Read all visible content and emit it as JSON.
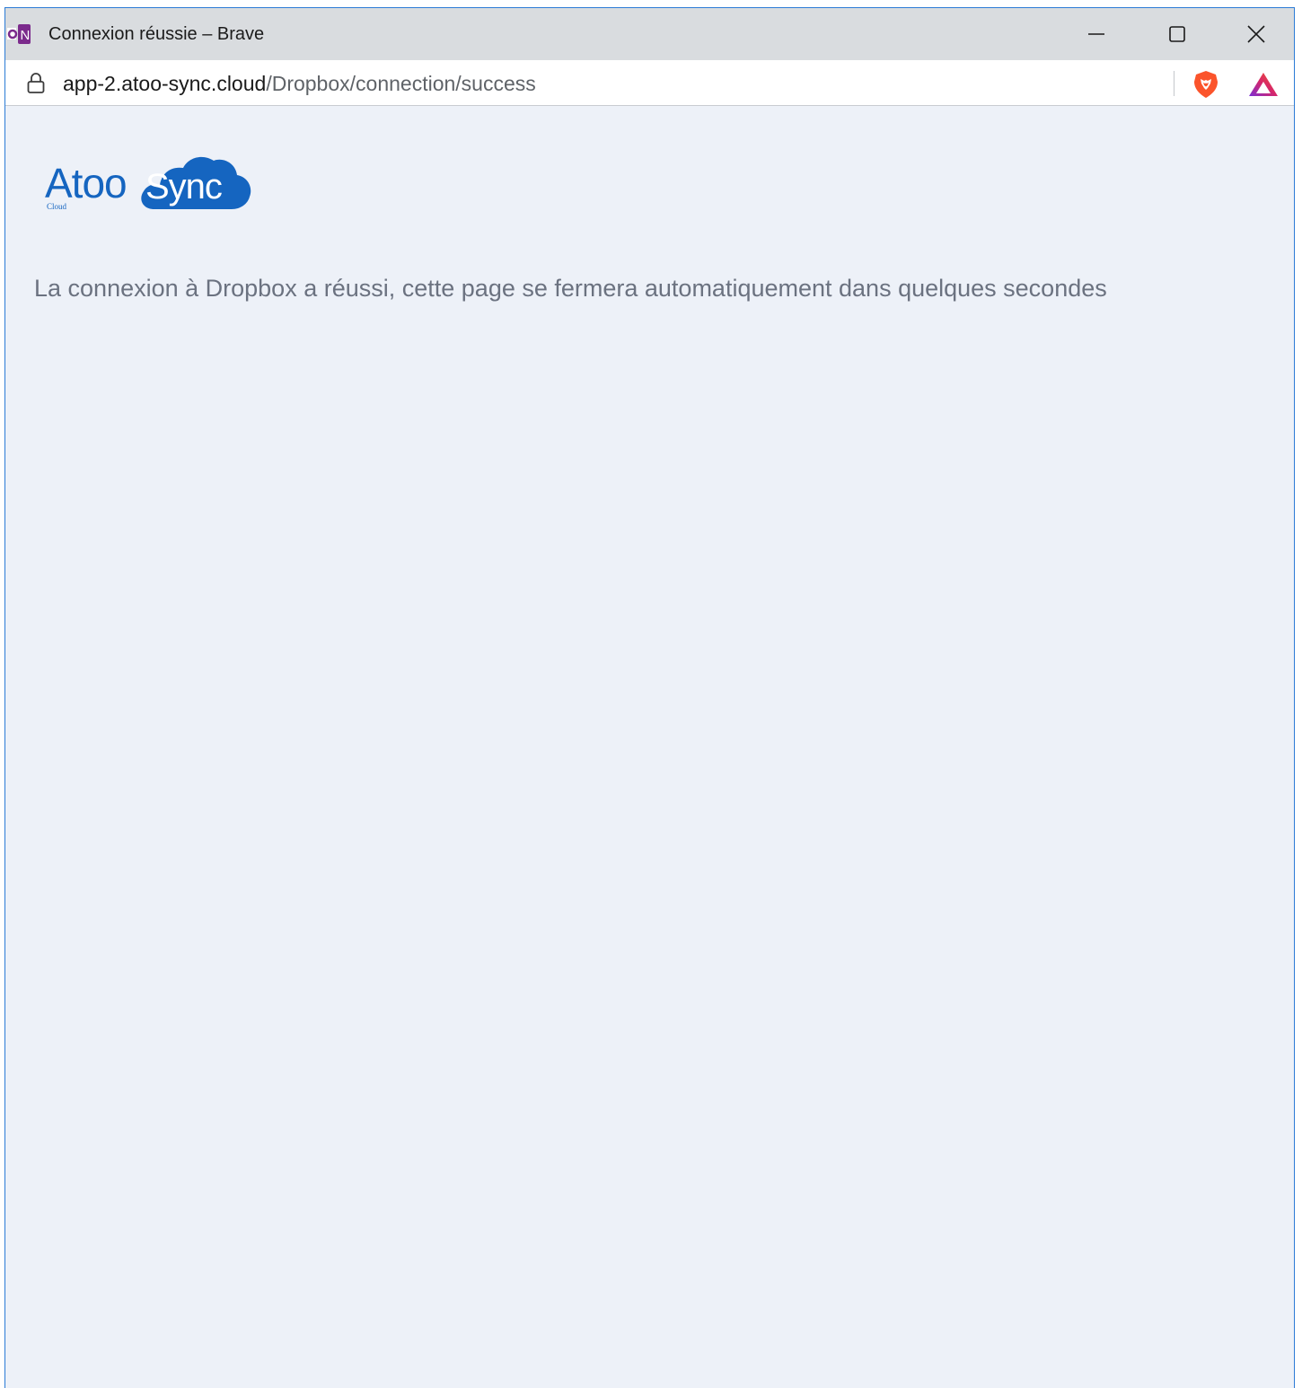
{
  "window": {
    "title": "Connexion réussie – Brave",
    "favicon_letter": "N",
    "controls": {
      "minimize_icon": "minimize-icon",
      "maximize_icon": "maximize-icon",
      "close_icon": "close-icon"
    }
  },
  "address_bar": {
    "url_host": "app-2.atoo-sync.cloud",
    "url_path": "/Dropbox/connection/success",
    "lock_icon": "lock-icon",
    "shield_icon": "brave-shield-icon",
    "rewards_icon": "brave-rewards-icon"
  },
  "page": {
    "logo": {
      "word_left": "Atoo",
      "word_right": "Sync",
      "subtext": "Cloud",
      "brand_color": "#1565c0"
    },
    "message": "La connexion à Dropbox a réussi, cette page se fermera automatiquement dans quelques secondes"
  },
  "colors": {
    "page_background": "#edf1f8",
    "titlebar_background": "#d9dcdf",
    "message_text": "#6b7280"
  }
}
